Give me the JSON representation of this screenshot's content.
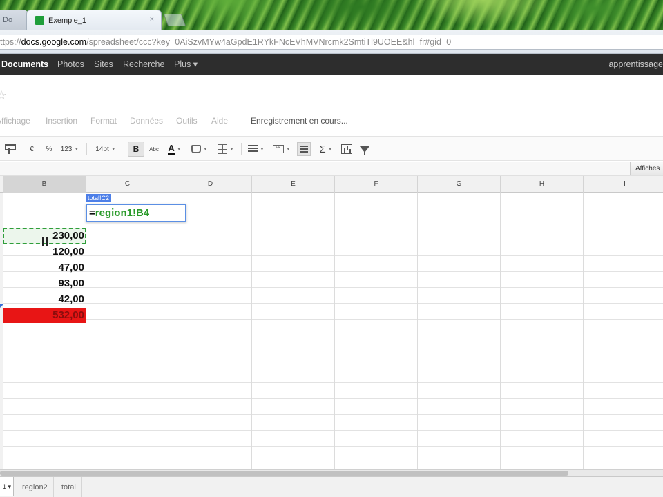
{
  "browser": {
    "left_tab_label": "Do",
    "active_tab_title": "Exemple_1",
    "tab_close": "×",
    "url_prefix": "ttps://",
    "url_host": "docs.google.com",
    "url_rest": "/spreadsheet/ccc?key=0AiSzvMYw4aGpdE1RYkFNcEVhMVNrcmk2SmtiTl9UOEE&hl=fr#gid=0"
  },
  "google_bar": {
    "items": [
      "Documents",
      "Photos",
      "Sites",
      "Recherche",
      "Plus ▾"
    ],
    "active": "Documents",
    "account": "apprentissage"
  },
  "menus": {
    "items": [
      "Affichage",
      "Insertion",
      "Format",
      "Données",
      "Outils",
      "Aide"
    ],
    "saving_status": "Enregistrement en cours..."
  },
  "toolbar": {
    "currency": "€",
    "percent": "%",
    "number_format": "123",
    "font_size": "14pt",
    "bold": "B",
    "strikethrough": "Abc",
    "text_color_letter": "A",
    "sigma": "Σ",
    "show_button": "Affiches"
  },
  "grid": {
    "columns": [
      "B",
      "C",
      "D",
      "E",
      "F",
      "G",
      "H",
      "I"
    ],
    "selected_column": "B",
    "values": [
      "230,00",
      "120,00",
      "47,00",
      "93,00",
      "42,00",
      "532,00"
    ],
    "cell_reference": "total!C2",
    "formula_equals": "=",
    "formula_ref": "region1!B4",
    "highlight_color": "#e81515"
  },
  "sheets": {
    "active_tab_fragment": "1 ▾",
    "tabs": [
      "region2",
      "total"
    ]
  }
}
